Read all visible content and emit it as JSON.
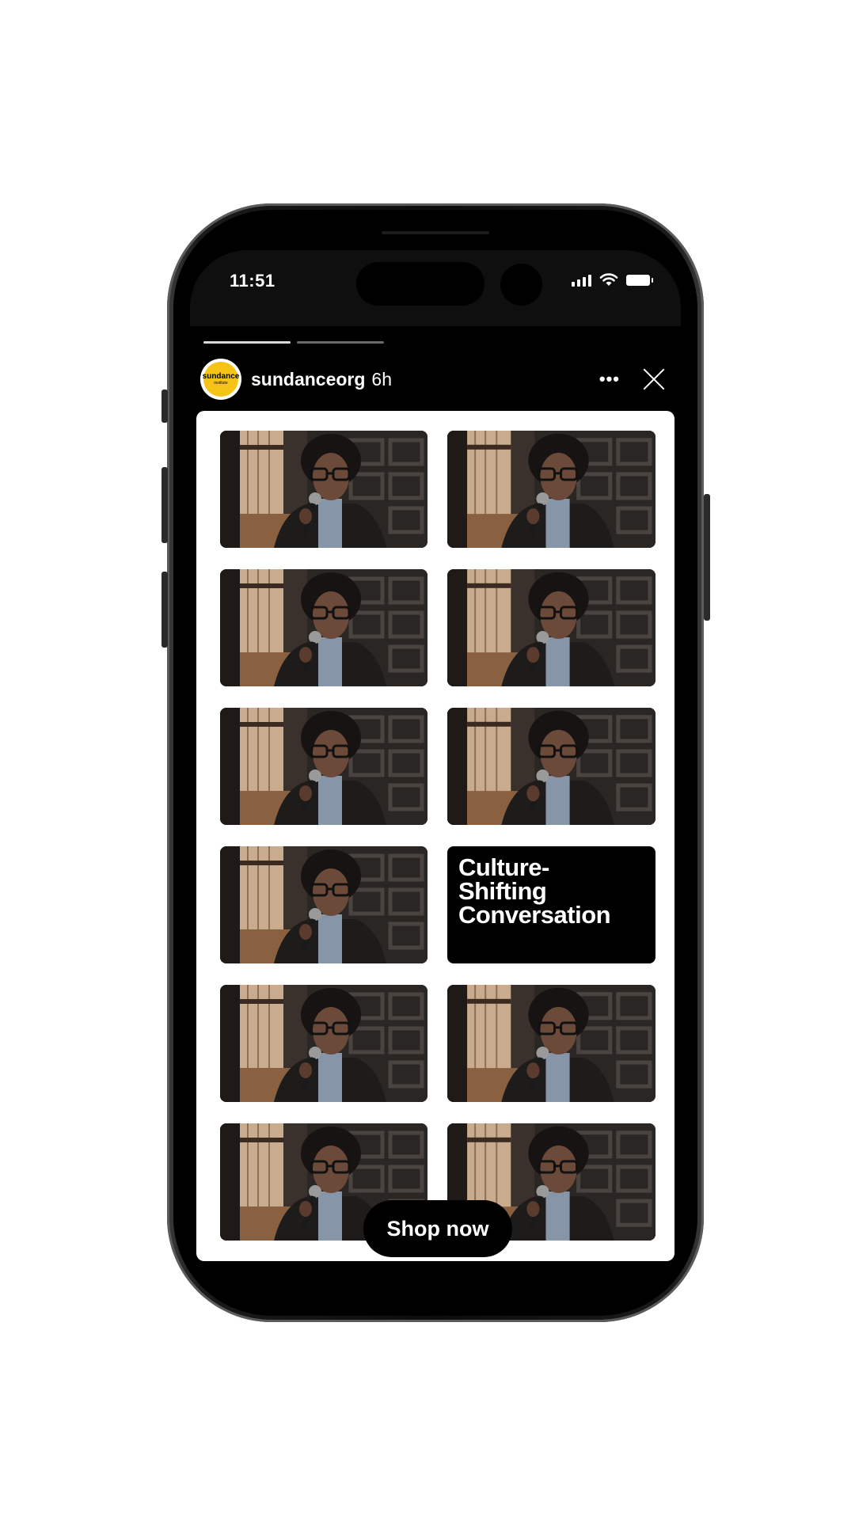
{
  "status_bar": {
    "time": "11:51",
    "icons": [
      "signal-icon",
      "wifi-icon",
      "battery-icon"
    ]
  },
  "story": {
    "progress": [
      1.0,
      0.0
    ],
    "username": "sundanceorg",
    "time_ago": "6h",
    "avatar": {
      "logo_text": "sundance",
      "logo_subtext": "institute",
      "accent": "#f6c416"
    },
    "more_icon": "more-horizontal-icon",
    "close_icon": "close-icon"
  },
  "content": {
    "tiles": [
      {
        "type": "photo"
      },
      {
        "type": "photo"
      },
      {
        "type": "photo"
      },
      {
        "type": "photo"
      },
      {
        "type": "photo"
      },
      {
        "type": "photo"
      },
      {
        "type": "photo"
      },
      {
        "type": "text",
        "text": "Culture-\nShifting\nConversation"
      },
      {
        "type": "photo"
      },
      {
        "type": "photo"
      },
      {
        "type": "photo"
      },
      {
        "type": "photo"
      }
    ]
  },
  "cta": {
    "label": "Shop now"
  }
}
